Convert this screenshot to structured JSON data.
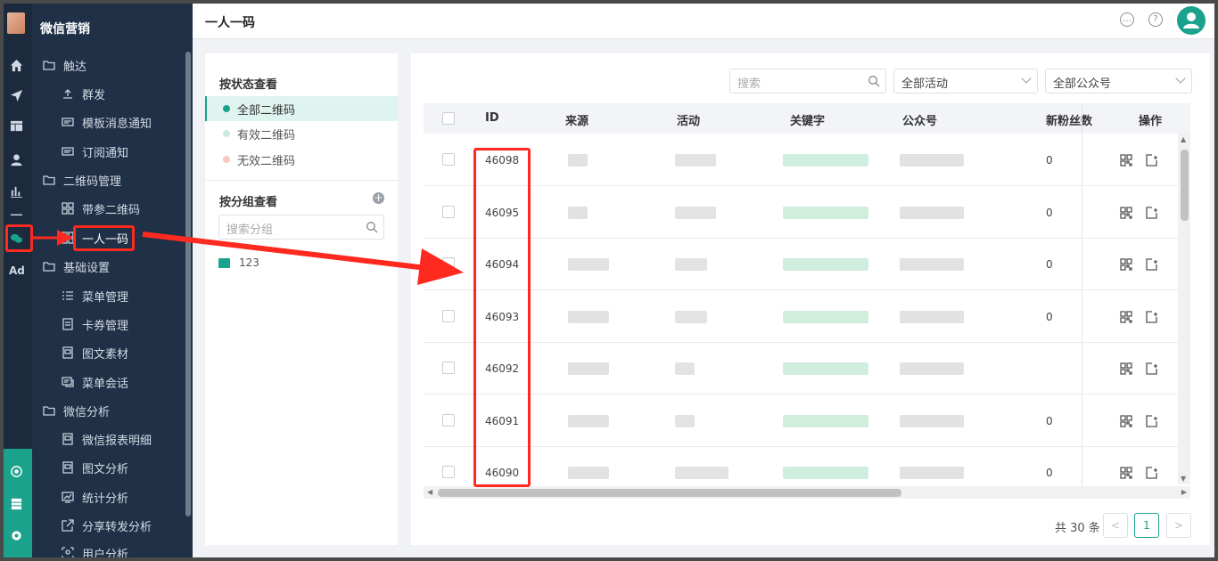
{
  "app": {
    "brand": "微信营销",
    "page_title": "一人一码"
  },
  "rail_icons": [
    "home-icon",
    "send-icon",
    "layout-icon",
    "user-icon",
    "bar-chart-icon",
    "dash-icon",
    "wechat-icon",
    "ad-icon"
  ],
  "rail_ad_label": "Ad",
  "sidebar": {
    "groups": [
      {
        "label": "触达",
        "icon": "folder-icon",
        "items": [
          {
            "label": "群发",
            "icon": "broadcast-icon"
          },
          {
            "label": "模板消息通知",
            "icon": "message-icon"
          },
          {
            "label": "订阅通知",
            "icon": "subscribe-icon"
          }
        ]
      },
      {
        "label": "二维码管理",
        "icon": "folder-icon",
        "items": [
          {
            "label": "带参二维码",
            "icon": "qrcode-icon"
          },
          {
            "label": "一人一码",
            "icon": "qrcode-icon",
            "active": true
          }
        ]
      },
      {
        "label": "基础设置",
        "icon": "folder-icon",
        "items": [
          {
            "label": "菜单管理",
            "icon": "menu-icon"
          },
          {
            "label": "卡券管理",
            "icon": "coupon-icon"
          },
          {
            "label": "图文素材",
            "icon": "article-icon"
          },
          {
            "label": "菜单会话",
            "icon": "chat-icon"
          }
        ]
      },
      {
        "label": "微信分析",
        "icon": "folder-icon",
        "items": [
          {
            "label": "微信报表明细",
            "icon": "report-icon"
          },
          {
            "label": "图文分析",
            "icon": "article-icon"
          },
          {
            "label": "统计分析",
            "icon": "stats-icon"
          },
          {
            "label": "分享转发分析",
            "icon": "share-icon"
          },
          {
            "label": "用户分析",
            "icon": "user-analysis-icon"
          }
        ]
      }
    ]
  },
  "filter_panel": {
    "status_heading": "按状态查看",
    "statuses": [
      {
        "label": "全部二维码",
        "color": "#1ba28c",
        "active": true
      },
      {
        "label": "有效二维码",
        "color": "#c7ecd9",
        "active": false
      },
      {
        "label": "无效二维码",
        "color": "#f6c9c4",
        "active": false
      }
    ],
    "group_heading": "按分组查看",
    "add_label": "+",
    "group_search_placeholder": "搜索分组",
    "groups": [
      {
        "label": "123"
      }
    ]
  },
  "toolbar": {
    "search_placeholder": "搜索",
    "activity_select": "全部活动",
    "account_select": "全部公众号"
  },
  "table": {
    "columns": [
      "ID",
      "来源",
      "活动",
      "关键字",
      "公众号",
      "新粉丝数",
      "操作"
    ],
    "rows": [
      {
        "id": "46098",
        "new_fans": "0"
      },
      {
        "id": "46095",
        "new_fans": "0"
      },
      {
        "id": "46094",
        "new_fans": "0"
      },
      {
        "id": "46093",
        "new_fans": "0"
      },
      {
        "id": "46092",
        "new_fans": ""
      },
      {
        "id": "46091",
        "new_fans": "0"
      },
      {
        "id": "46090",
        "new_fans": "0"
      }
    ]
  },
  "pagination": {
    "total": "共 30 条",
    "prev": "<",
    "current": "1",
    "next": ">"
  },
  "colors": {
    "accent": "#1ba28c",
    "sidebar_bg": "#1f3047",
    "annotation": "#ff2a1f"
  }
}
